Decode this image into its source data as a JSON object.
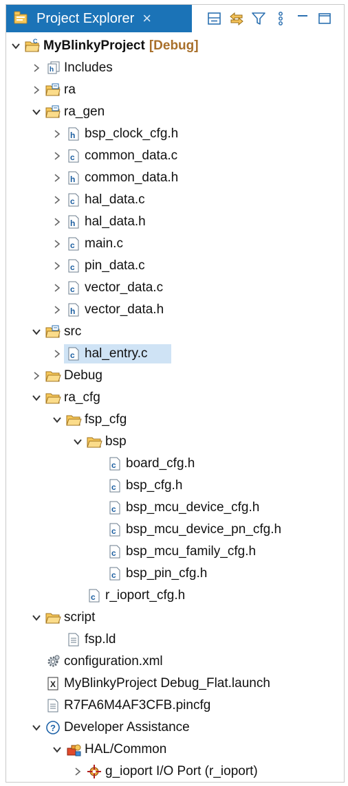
{
  "panel": {
    "title": "Project Explorer",
    "close_glyph": "×",
    "toolbar": [
      {
        "name": "collapse-all-icon"
      },
      {
        "name": "link-with-editor-icon"
      },
      {
        "name": "filter-icon"
      },
      {
        "name": "view-menu-icon"
      },
      {
        "name": "minimize-icon"
      },
      {
        "name": "maximize-icon"
      }
    ]
  },
  "colors": {
    "tab_active": "#1b73b7",
    "selection": "#cfe3f5",
    "decoration": "#a86f2a"
  },
  "tree": [
    {
      "label": "MyBlinkyProject",
      "decoration": "[Debug]",
      "depth": 0,
      "state": "expanded",
      "icon": "project",
      "bold": true
    },
    {
      "label": "Includes",
      "depth": 1,
      "state": "collapsed",
      "icon": "includes"
    },
    {
      "label": "ra",
      "depth": 1,
      "state": "collapsed",
      "icon": "source-folder"
    },
    {
      "label": "ra_gen",
      "depth": 1,
      "state": "expanded",
      "icon": "source-folder"
    },
    {
      "label": "bsp_clock_cfg.h",
      "depth": 2,
      "state": "collapsed",
      "icon": "h-file"
    },
    {
      "label": "common_data.c",
      "depth": 2,
      "state": "collapsed",
      "icon": "c-file"
    },
    {
      "label": "common_data.h",
      "depth": 2,
      "state": "collapsed",
      "icon": "h-file"
    },
    {
      "label": "hal_data.c",
      "depth": 2,
      "state": "collapsed",
      "icon": "c-file"
    },
    {
      "label": "hal_data.h",
      "depth": 2,
      "state": "collapsed",
      "icon": "h-file"
    },
    {
      "label": "main.c",
      "depth": 2,
      "state": "collapsed",
      "icon": "c-file"
    },
    {
      "label": "pin_data.c",
      "depth": 2,
      "state": "collapsed",
      "icon": "c-file"
    },
    {
      "label": "vector_data.c",
      "depth": 2,
      "state": "collapsed",
      "icon": "c-file"
    },
    {
      "label": "vector_data.h",
      "depth": 2,
      "state": "collapsed",
      "icon": "h-file"
    },
    {
      "label": "src",
      "depth": 1,
      "state": "expanded",
      "icon": "source-folder"
    },
    {
      "label": "hal_entry.c",
      "depth": 2,
      "state": "collapsed",
      "icon": "c-file",
      "selected": true
    },
    {
      "label": "Debug",
      "depth": 1,
      "state": "collapsed",
      "icon": "folder"
    },
    {
      "label": "ra_cfg",
      "depth": 1,
      "state": "expanded",
      "icon": "folder"
    },
    {
      "label": "fsp_cfg",
      "depth": 2,
      "state": "expanded",
      "icon": "folder"
    },
    {
      "label": "bsp",
      "depth": 3,
      "state": "expanded",
      "icon": "folder"
    },
    {
      "label": "board_cfg.h",
      "depth": 4,
      "state": "leaf",
      "icon": "c-file"
    },
    {
      "label": "bsp_cfg.h",
      "depth": 4,
      "state": "leaf",
      "icon": "c-file"
    },
    {
      "label": "bsp_mcu_device_cfg.h",
      "depth": 4,
      "state": "leaf",
      "icon": "c-file"
    },
    {
      "label": "bsp_mcu_device_pn_cfg.h",
      "depth": 4,
      "state": "leaf",
      "icon": "c-file"
    },
    {
      "label": "bsp_mcu_family_cfg.h",
      "depth": 4,
      "state": "leaf",
      "icon": "c-file"
    },
    {
      "label": "bsp_pin_cfg.h",
      "depth": 4,
      "state": "leaf",
      "icon": "c-file"
    },
    {
      "label": "r_ioport_cfg.h",
      "depth": 3,
      "state": "leaf",
      "icon": "c-file"
    },
    {
      "label": "script",
      "depth": 1,
      "state": "expanded",
      "icon": "folder"
    },
    {
      "label": "fsp.ld",
      "depth": 2,
      "state": "leaf",
      "icon": "text-file"
    },
    {
      "label": "configuration.xml",
      "depth": 1,
      "state": "leaf",
      "icon": "gear-file"
    },
    {
      "label": "MyBlinkyProject Debug_Flat.launch",
      "depth": 1,
      "state": "leaf",
      "icon": "launch-file"
    },
    {
      "label": "R7FA6M4AF3CFB.pincfg",
      "depth": 1,
      "state": "leaf",
      "icon": "text-file"
    },
    {
      "label": "Developer Assistance",
      "depth": 1,
      "state": "expanded",
      "icon": "help"
    },
    {
      "label": "HAL/Common",
      "depth": 2,
      "state": "expanded",
      "icon": "module"
    },
    {
      "label": "g_ioport I/O Port (r_ioport)",
      "depth": 3,
      "state": "collapsed",
      "icon": "port"
    }
  ]
}
